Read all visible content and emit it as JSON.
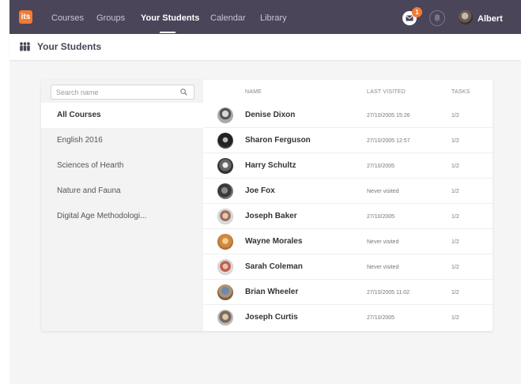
{
  "nav": {
    "logo": "its",
    "items": [
      "Courses",
      "Groups",
      "Your Students",
      "Calendar",
      "Library"
    ],
    "active": "Your Students",
    "notifications": "1",
    "user": "Albert"
  },
  "header": {
    "title": "Your Students"
  },
  "sidebar": {
    "search_placeholder": "Search name",
    "courses": [
      "All Courses",
      "English 2016",
      "Sciences of Hearth",
      "Nature and Fauna",
      "Digital Age Methodologi..."
    ],
    "active_course": "All Courses"
  },
  "table": {
    "columns": {
      "name": "NAME",
      "last_visited": "LAST VISITED",
      "tasks": "TASKS"
    },
    "rows": [
      {
        "name": "Denise Dixon",
        "last_visited": "27/10/2005 15:26",
        "tasks": "1/2"
      },
      {
        "name": "Sharon Ferguson",
        "last_visited": "27/10/2005 12:57",
        "tasks": "1/2"
      },
      {
        "name": "Harry Schultz",
        "last_visited": "27/10/2005",
        "tasks": "1/2"
      },
      {
        "name": "Joe Fox",
        "last_visited": "Never visited",
        "tasks": "1/2"
      },
      {
        "name": "Joseph Baker",
        "last_visited": "27/10/2005",
        "tasks": "1/2"
      },
      {
        "name": "Wayne Morales",
        "last_visited": "Never visited",
        "tasks": "1/2"
      },
      {
        "name": "Sarah Coleman",
        "last_visited": "Never visited",
        "tasks": "1/2"
      },
      {
        "name": "Brian Wheeler",
        "last_visited": "27/10/2005 11:02",
        "tasks": "1/2"
      },
      {
        "name": "Joseph Curtis",
        "last_visited": "27/10/2005",
        "tasks": "1/2"
      }
    ]
  },
  "colors": {
    "nav_bg": "#4a4558",
    "accent": "#ef7b34"
  }
}
